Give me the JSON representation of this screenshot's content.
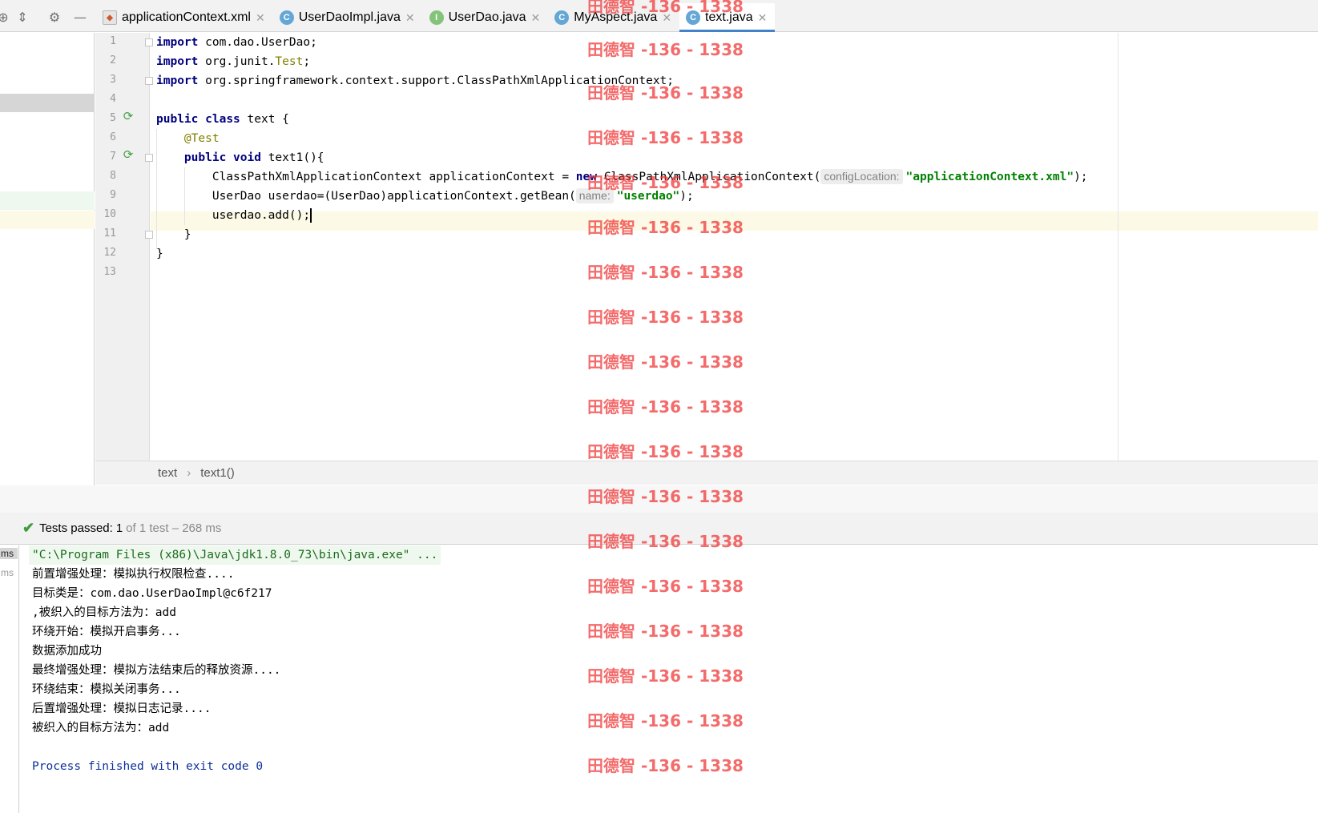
{
  "toolbar": {
    "icons": [
      "target-icon",
      "collapse-icon",
      "gear-icon",
      "minimize-icon"
    ]
  },
  "tabs": [
    {
      "label": "applicationContext.xml",
      "icon": "xml-file-icon",
      "active": false
    },
    {
      "label": "UserDaoImpl.java",
      "icon": "class-icon",
      "active": false
    },
    {
      "label": "UserDao.java",
      "icon": "interface-icon",
      "active": false
    },
    {
      "label": "MyAspect.java",
      "icon": "class-icon",
      "active": false
    },
    {
      "label": "text.java",
      "icon": "test-class-icon",
      "active": true
    }
  ],
  "editor": {
    "line_numbers": [
      "1",
      "2",
      "3",
      "4",
      "5",
      "6",
      "7",
      "8",
      "9",
      "10",
      "11",
      "12",
      "13"
    ],
    "current_line": "10",
    "lines": {
      "l1": {
        "kw": "import",
        "rest": " com.dao.UserDao;"
      },
      "l2": {
        "kw": "import",
        "pre": " org.junit.",
        "cls": "Test",
        "post": ";"
      },
      "l3": {
        "kw": "import",
        "rest": " org.springframework.context.support.ClassPathXmlApplicationContext;"
      },
      "l5": {
        "kw1": "public",
        "kw2": "class",
        "rest": " text {"
      },
      "l6": {
        "anno": "@Test"
      },
      "l7": {
        "kw1": "public",
        "kw2": "void",
        "rest": " text1(){"
      },
      "l8": {
        "pre": "ClassPathXmlApplicationContext applicationContext = ",
        "kw": "new",
        "mid": " ClassPathXmlApplicationContext(",
        "hint": "configLocation:",
        "str": "\"applicationContext.xml\"",
        "post": ");"
      },
      "l9": {
        "pre": "UserDao userdao=(UserDao)applicationContext.getBean(",
        "hint": "name:",
        "str": "\"userdao\"",
        "post": ");"
      },
      "l10": {
        "code": "userdao.add();"
      },
      "l11": {
        "code": "}"
      },
      "l12": {
        "code": "}"
      }
    }
  },
  "breadcrumb": {
    "items": [
      "text",
      "text1()"
    ],
    "separator": "›"
  },
  "run": {
    "status": {
      "label": "Tests passed:",
      "count": "1",
      "rest": "of 1 test – 268 ms"
    },
    "tree": [
      "ms",
      "ms"
    ],
    "console": [
      "\"C:\\Program Files (x86)\\Java\\jdk1.8.0_73\\bin\\java.exe\" ...",
      "前置增强处理：模拟执行权限检查....",
      "目标类是：com.dao.UserDaoImpl@c6f217",
      ",被织入的目标方法为：add",
      "环绕开始：模拟开启事务...",
      "数据添加成功",
      "最终增强处理：模拟方法结束后的释放资源....",
      "环绕结束：模拟关闭事务...",
      "后置增强处理：模拟日志记录....",
      "被织入的目标方法为：add",
      "",
      "Process finished with exit code 0"
    ]
  },
  "watermark": {
    "text": "田德智 -136 - 1338"
  },
  "colors": {
    "keyword": "#000080",
    "string": "#008000",
    "annotation": "#808000",
    "active_tab_underline": "#4083c9",
    "pass_green": "#3e9b3e",
    "watermark": "#f03232"
  }
}
